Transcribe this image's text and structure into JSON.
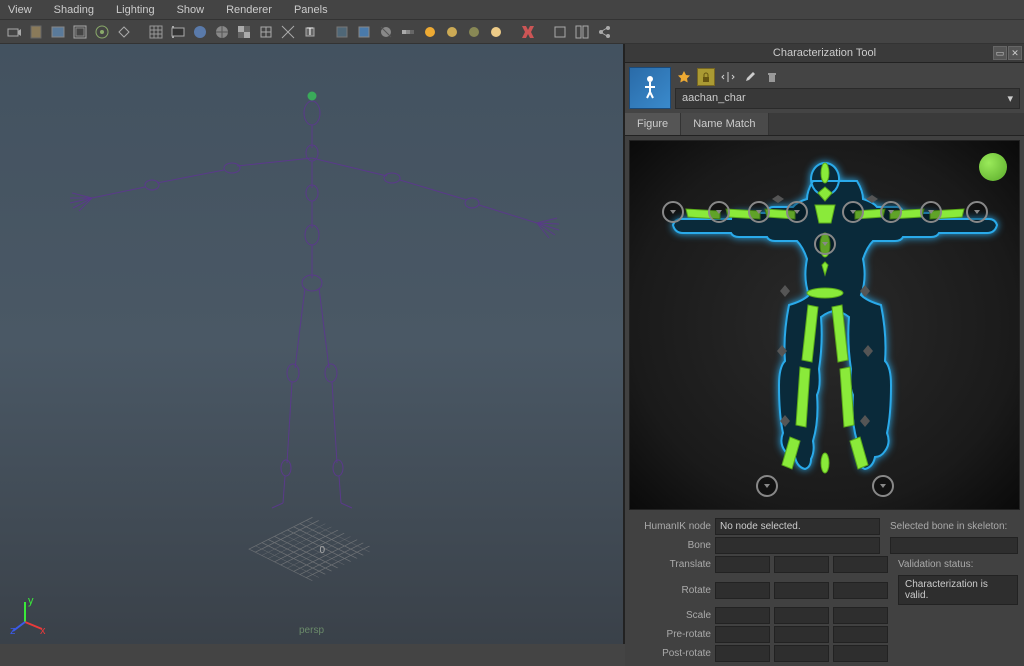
{
  "menu": [
    "View",
    "Shading",
    "Lighting",
    "Show",
    "Renderer",
    "Panels"
  ],
  "panel": {
    "title": "Characterization Tool"
  },
  "character": {
    "name": "aachan_char"
  },
  "tabs": {
    "figure": "Figure",
    "nameMatch": "Name Match"
  },
  "props": {
    "humanik_label": "HumanIK node",
    "humanik_value": "No node selected.",
    "selected_bone_label": "Selected bone in skeleton:",
    "bone_label": "Bone",
    "translate_label": "Translate",
    "rotate_label": "Rotate",
    "scale_label": "Scale",
    "prerotate_label": "Pre-rotate",
    "postrotate_label": "Post-rotate",
    "validation_label": "Validation status:",
    "validation_value": "Characterization is valid."
  },
  "viewport": {
    "camera": "persp",
    "grid_label": "0"
  }
}
